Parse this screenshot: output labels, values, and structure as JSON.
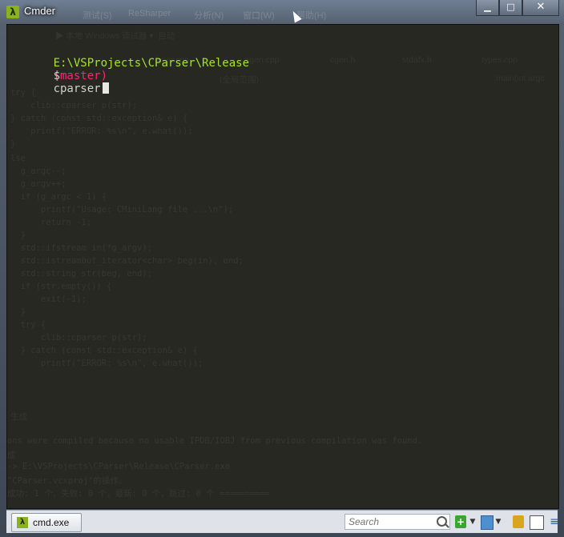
{
  "window": {
    "title": "Cmder",
    "app_icon": "λ",
    "bleed_menu": [
      "测试(S)",
      "ReSharper",
      "分析(N)",
      "窗口(W)",
      "帮助(H)"
    ],
    "controls": {
      "minimize": "▁",
      "maximize": "□",
      "close": "✕"
    }
  },
  "ghost": {
    "toolbar": "▶ 本地 Windows 调试器 ▾  自动",
    "file_tabs": [
      "lexer.cpp",
      "cgen.cpp",
      "cgen.h",
      "stdafx.h",
      "types.cpp"
    ],
    "scope": "(全局范围)",
    "function": "main(int argc",
    "code": [
      "try {",
      "    clib::cparser p(str);",
      "} catch (const std::exception& e) {",
      "    printf(\"ERROR: %s\\n\", e.what());",
      "}",
      "",
      "lse",
      "  g_argc--;",
      "  g_argv++;",
      "  if (g_argc < 1) {",
      "      printf(\"Usage: CMiniLang file ...\\n\");",
      "      return -1;",
      "  }",
      "  std::ifstream in(*g_argv);",
      "  std::istreambuf_iterator<char> beg(in), end;",
      "  std::string str(beg, end);",
      "  if (str.empty()) {",
      "      exit(-1);",
      "  }",
      "  try {",
      "      clib::cparser p(str);",
      "  } catch (const std::exception& e) {",
      "      printf(\"ERROR: %s\\n\", e.what());"
    ],
    "output_title": "生成",
    "output_lines": [
      "ons were compiled because no usable IPDB/IOBJ from previous compilation was found.",
      "成",
      "-> E:\\VSProjects\\CParser\\Release\\CParser.exe",
      "\"CParser.vcxproj\"的操作。",
      "成功: 1 个，失败: 0 个，最新: 0 个，跳过: 0 个 =========="
    ]
  },
  "terminal": {
    "path": "E:\\VSProjects\\CParser\\Release",
    "branch": "(master)",
    "prompt_symbol": "$",
    "command": "cparser"
  },
  "statusbar": {
    "tab_icon": "λ",
    "tab_label": "cmd.exe",
    "search_placeholder": "Search",
    "plus": "+",
    "dropdown": "▼",
    "menu": "≡"
  },
  "colors": {
    "terminal_bg": "#272822",
    "path": "#a6e22e",
    "branch": "#f92672",
    "text": "#d0d0c8"
  }
}
